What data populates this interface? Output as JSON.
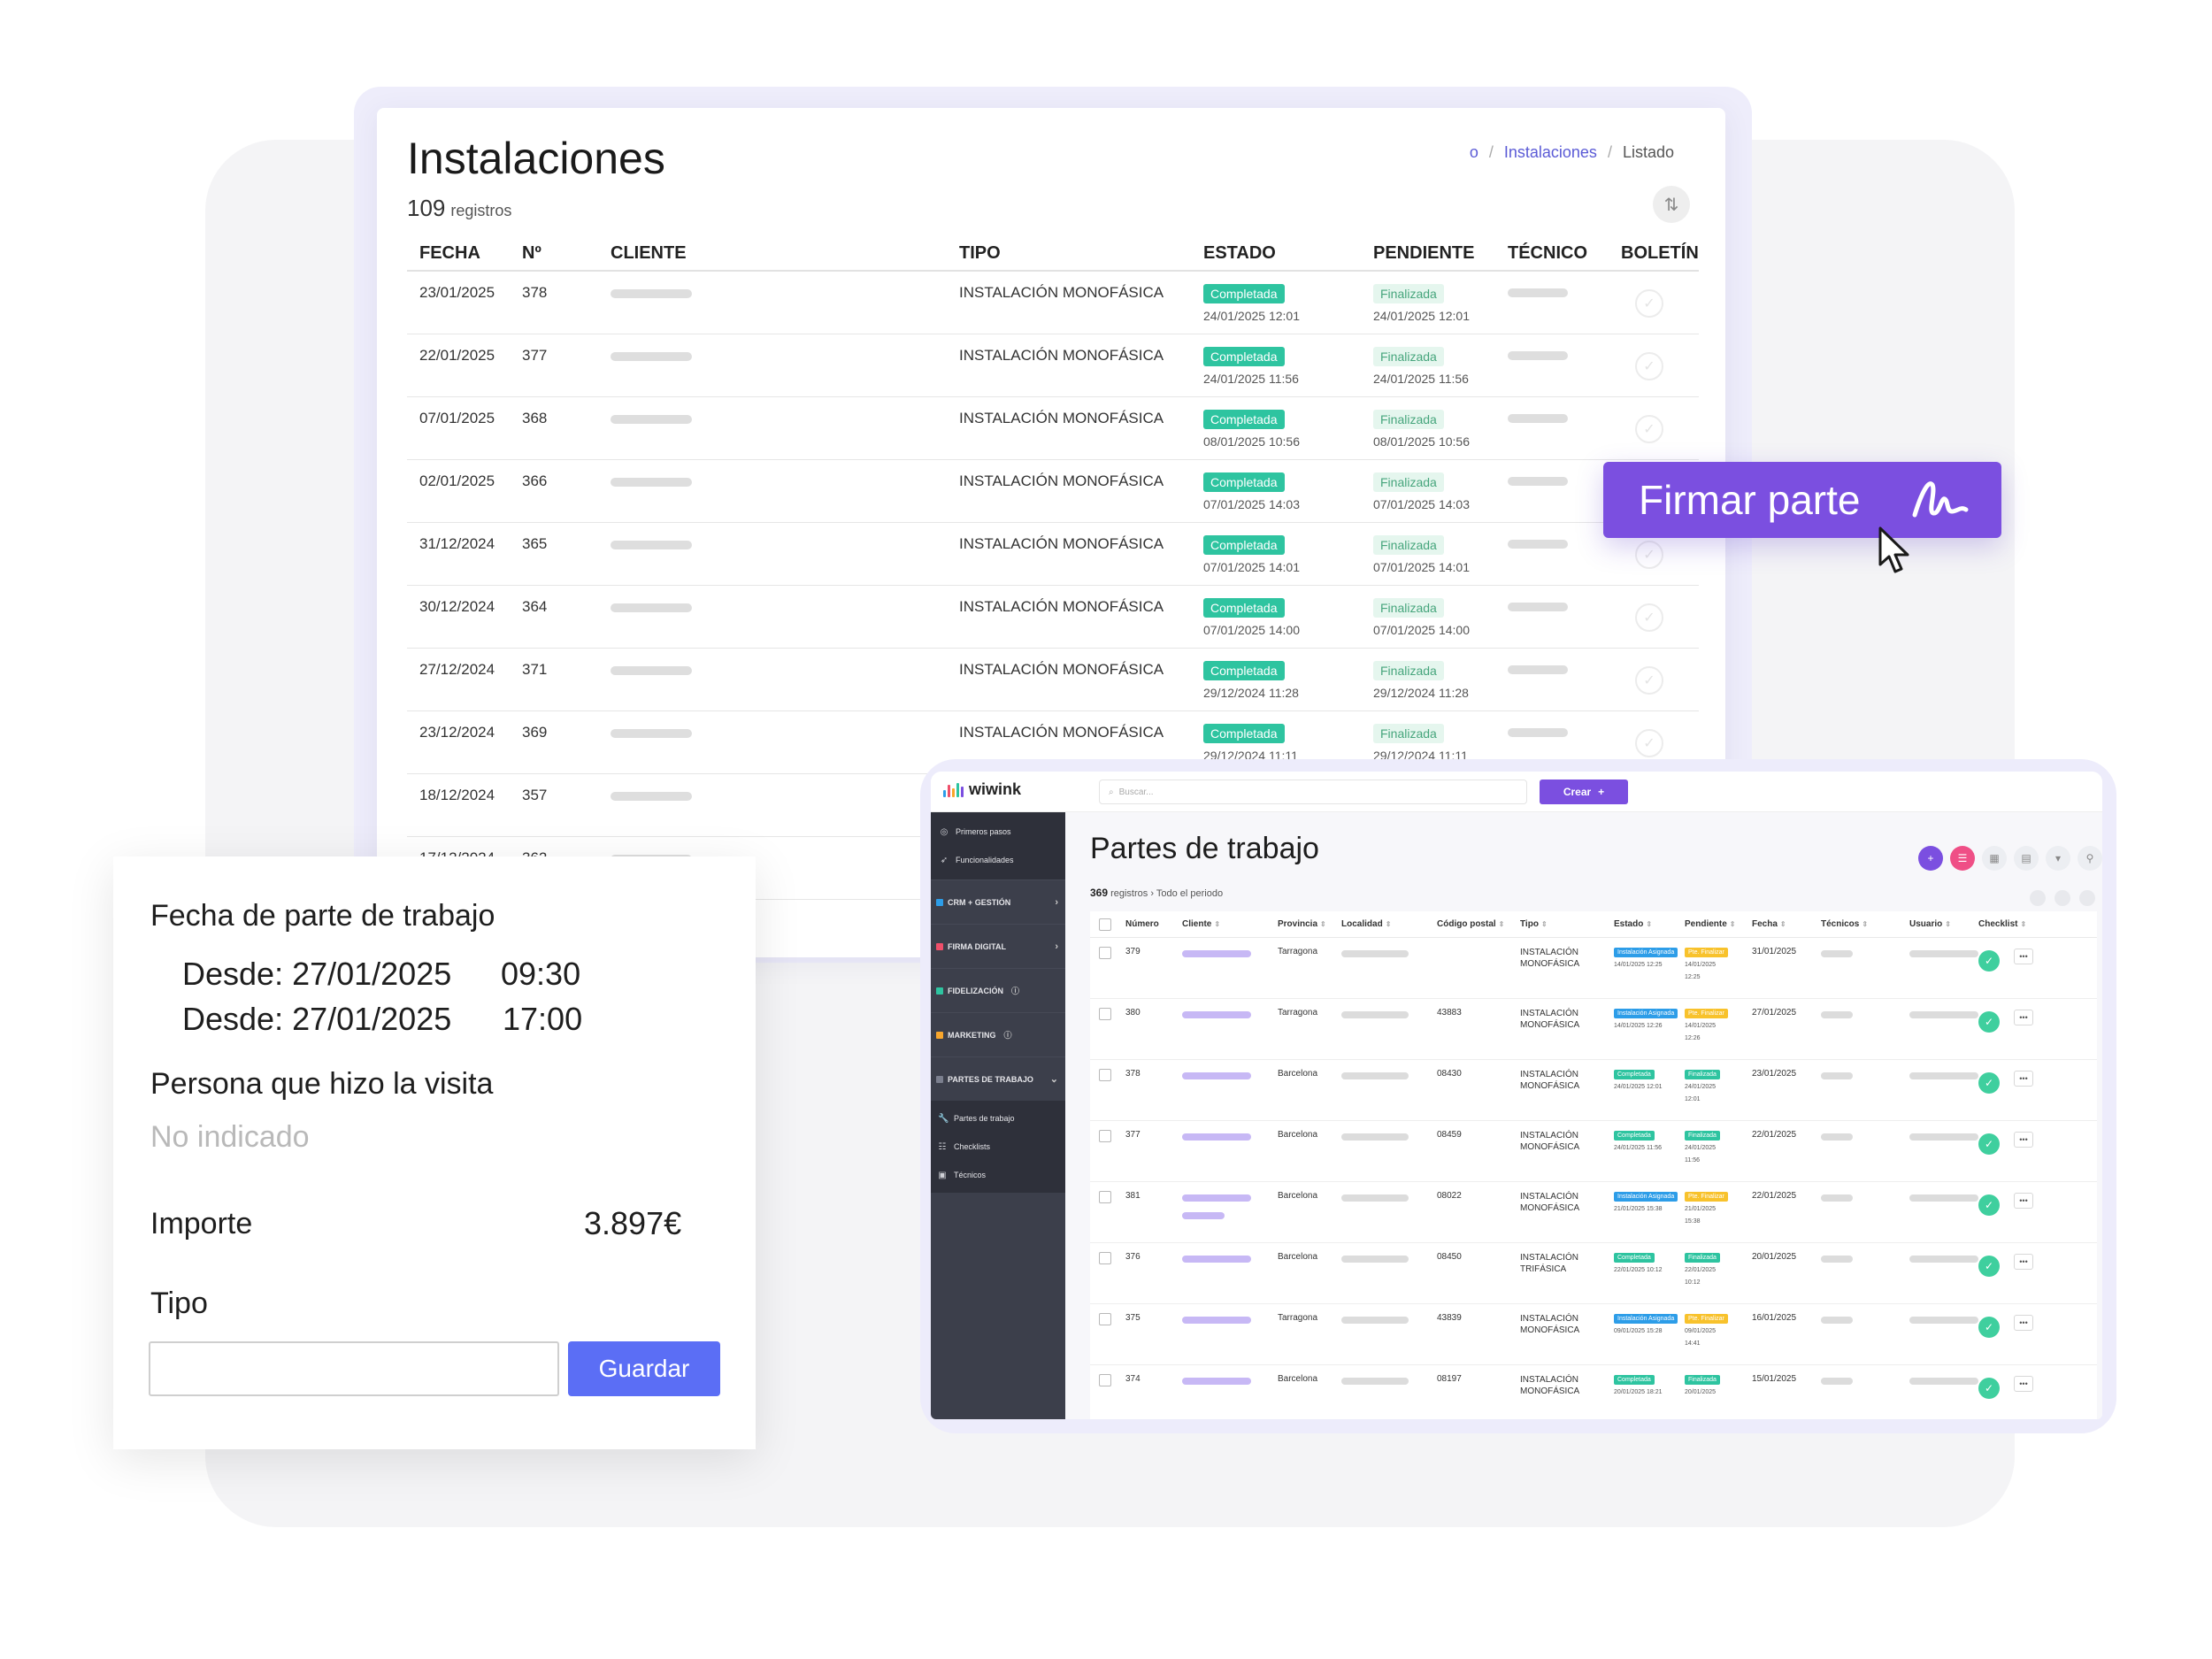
{
  "instalaciones": {
    "title": "Instalaciones",
    "count": "109",
    "count_label": "registros",
    "breadcrumb": [
      "o",
      "Instalaciones",
      "Listado"
    ],
    "headers": [
      "FECHA",
      "Nº",
      "CLIENTE",
      "TIPO",
      "ESTADO",
      "PENDIENTE",
      "TÉCNICO",
      "BOLETÍN"
    ],
    "rows": [
      {
        "fecha": "23/01/2025",
        "num": "378",
        "tipo": "INSTALACIÓN MONOFÁSICA",
        "estado": "Completada",
        "estado_fecha": "24/01/2025 12:01",
        "pendiente": "Finalizada",
        "pendiente_fecha": "24/01/2025 12:01"
      },
      {
        "fecha": "22/01/2025",
        "num": "377",
        "tipo": "INSTALACIÓN MONOFÁSICA",
        "estado": "Completada",
        "estado_fecha": "24/01/2025 11:56",
        "pendiente": "Finalizada",
        "pendiente_fecha": "24/01/2025 11:56"
      },
      {
        "fecha": "07/01/2025",
        "num": "368",
        "tipo": "INSTALACIÓN MONOFÁSICA",
        "estado": "Completada",
        "estado_fecha": "08/01/2025 10:56",
        "pendiente": "Finalizada",
        "pendiente_fecha": "08/01/2025 10:56"
      },
      {
        "fecha": "02/01/2025",
        "num": "366",
        "tipo": "INSTALACIÓN MONOFÁSICA",
        "estado": "Completada",
        "estado_fecha": "07/01/2025 14:03",
        "pendiente": "Finalizada",
        "pendiente_fecha": "07/01/2025 14:03"
      },
      {
        "fecha": "31/12/2024",
        "num": "365",
        "tipo": "INSTALACIÓN MONOFÁSICA",
        "estado": "Completada",
        "estado_fecha": "07/01/2025 14:01",
        "pendiente": "Finalizada",
        "pendiente_fecha": "07/01/2025 14:01"
      },
      {
        "fecha": "30/12/2024",
        "num": "364",
        "tipo": "INSTALACIÓN MONOFÁSICA",
        "estado": "Completada",
        "estado_fecha": "07/01/2025 14:00",
        "pendiente": "Finalizada",
        "pendiente_fecha": "07/01/2025 14:00"
      },
      {
        "fecha": "27/12/2024",
        "num": "371",
        "tipo": "INSTALACIÓN MONOFÁSICA",
        "estado": "Completada",
        "estado_fecha": "29/12/2024 11:28",
        "pendiente": "Finalizada",
        "pendiente_fecha": "29/12/2024 11:28"
      },
      {
        "fecha": "23/12/2024",
        "num": "369",
        "tipo": "INSTALACIÓN MONOFÁSICA",
        "estado": "Completada",
        "estado_fecha": "29/12/2024 11:11",
        "pendiente": "Finalizada",
        "pendiente_fecha": "29/12/2024 11:11"
      },
      {
        "fecha": "18/12/2024",
        "num": "357"
      },
      {
        "fecha": "17/12/2024",
        "num": "362"
      }
    ]
  },
  "firmar": {
    "label": "Firmar parte"
  },
  "form": {
    "fecha_label": "Fecha de parte de trabajo",
    "desde1_label": "Desde: 27/01/2025",
    "desde1_time": "09:30",
    "desde2_label": "Desde: 27/01/2025",
    "desde2_time": "17:00",
    "persona_label": "Persona que hizo la visita",
    "persona_value": "No indicado",
    "importe_label": "Importe",
    "importe_value": "3.897€",
    "tipo_label": "Tipo",
    "save_label": "Guardar"
  },
  "wiwink": {
    "brand": "wiwink",
    "search_placeholder": "Buscar...",
    "crear_label": "Crear",
    "sidebar": {
      "top": [
        "Primeros pasos",
        "Funcionalidades"
      ],
      "sections": [
        {
          "label": "CRM + GESTIÓN",
          "color": "#2d9de8"
        },
        {
          "label": "FIRMA DIGITAL",
          "color": "#ef4f6a"
        },
        {
          "label": "FIDELIZACIÓN",
          "color": "#2ec4a0"
        },
        {
          "label": "MARKETING",
          "color": "#f8a62c"
        },
        {
          "label": "PARTES DE TRABAJO",
          "color": "#7b7f8e"
        }
      ],
      "sub": [
        "Partes de trabajo",
        "Checklists",
        "Técnicos"
      ]
    },
    "title": "Partes de trabajo",
    "count": "369",
    "count_label": "registros",
    "period": "Todo el periodo",
    "headers": [
      "Número",
      "Cliente",
      "Provincia",
      "Localidad",
      "Código postal",
      "Tipo",
      "Estado",
      "Pendiente",
      "Fecha",
      "Técnicos",
      "Usuario",
      "Checklist"
    ],
    "rows": [
      {
        "num": "379",
        "provincia": "Tarragona",
        "cp": "",
        "tipo": [
          "INSTALACIÓN",
          "MONOFÁSICA"
        ],
        "estado": "Instalación Asignada",
        "estado_color": "blue",
        "estado_fecha": "14/01/2025 12:25",
        "pend": "Pte. Finalizar",
        "pend_color": "yellow",
        "pend_fecha": [
          "14/01/2025",
          "12:25"
        ],
        "fecha": "31/01/2025"
      },
      {
        "num": "380",
        "provincia": "Tarragona",
        "cp": "43883",
        "tipo": [
          "INSTALACIÓN",
          "MONOFÁSICA"
        ],
        "estado": "Instalación Asignada",
        "estado_color": "blue",
        "estado_fecha": "14/01/2025 12:26",
        "pend": "Pte. Finalizar",
        "pend_color": "yellow",
        "pend_fecha": [
          "14/01/2025",
          "12:26"
        ],
        "fecha": "27/01/2025"
      },
      {
        "num": "378",
        "provincia": "Barcelona",
        "cp": "08430",
        "tipo": [
          "INSTALACIÓN",
          "MONOFÁSICA"
        ],
        "estado": "Completada",
        "estado_color": "green",
        "estado_fecha": "24/01/2025 12:01",
        "pend": "Finalizada",
        "pend_color": "green",
        "pend_fecha": [
          "24/01/2025",
          "12:01"
        ],
        "fecha": "23/01/2025"
      },
      {
        "num": "377",
        "provincia": "Barcelona",
        "cp": "08459",
        "tipo": [
          "INSTALACIÓN",
          "MONOFÁSICA"
        ],
        "estado": "Completada",
        "estado_color": "green",
        "estado_fecha": "24/01/2025 11:56",
        "pend": "Finalizada",
        "pend_color": "green",
        "pend_fecha": [
          "24/01/2025",
          "11:56"
        ],
        "fecha": "22/01/2025"
      },
      {
        "num": "381",
        "provincia": "Barcelona",
        "cp": "08022",
        "tipo": [
          "INSTALACIÓN",
          "MONOFÁSICA"
        ],
        "estado": "Instalación Asignada",
        "estado_color": "blue",
        "estado_fecha": "21/01/2025 15:38",
        "pend": "Pte. Finalizar",
        "pend_color": "yellow",
        "pend_fecha": [
          "21/01/2025",
          "15:38"
        ],
        "fecha": "22/01/2025"
      },
      {
        "num": "376",
        "provincia": "Barcelona",
        "cp": "08450",
        "tipo": [
          "INSTALACIÓN",
          "TRIFÁSICA"
        ],
        "estado": "Completada",
        "estado_color": "green",
        "estado_fecha": "22/01/2025 10:12",
        "pend": "Finalizada",
        "pend_color": "green",
        "pend_fecha": [
          "22/01/2025",
          "10:12"
        ],
        "fecha": "20/01/2025"
      },
      {
        "num": "375",
        "provincia": "Tarragona",
        "cp": "43839",
        "tipo": [
          "INSTALACIÓN",
          "MONOFÁSICA"
        ],
        "estado": "Instalación Asignada",
        "estado_color": "blue",
        "estado_fecha": "09/01/2025 15:28",
        "pend": "Pte. Finalizar",
        "pend_color": "yellow",
        "pend_fecha": [
          "09/01/2025",
          "14:41"
        ],
        "fecha": "16/01/2025"
      },
      {
        "num": "374",
        "provincia": "Barcelona",
        "cp": "08197",
        "tipo": [
          "INSTALACIÓN",
          "MONOFÁSICA"
        ],
        "estado": "Completada",
        "estado_color": "green",
        "estado_fecha": "20/01/2025 18:21",
        "pend": "Finalizada",
        "pend_color": "green",
        "pend_fecha": [
          "20/01/2025",
          ""
        ],
        "fecha": "15/01/2025"
      }
    ]
  }
}
